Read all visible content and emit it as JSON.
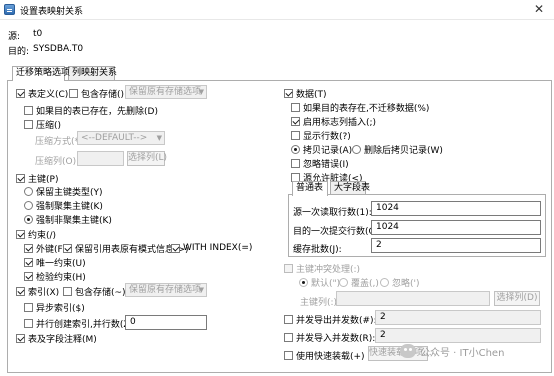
{
  "window": {
    "title": "设置表映射关系",
    "close_glyph": "✕"
  },
  "source": {
    "label": "源:",
    "value": "t0"
  },
  "target": {
    "label": "目的:",
    "value": "SYSDBA.T0"
  },
  "tabs": [
    {
      "label": "迁移策略选项",
      "active": true
    },
    {
      "label": "列映射关系",
      "active": false
    }
  ],
  "left": {
    "table_def": {
      "label": "表定义(C)",
      "checked": true
    },
    "include_storage": {
      "label": "包含存储()",
      "checked": false
    },
    "storage_combo1": "保留原有存储选项",
    "drop_if_exists": {
      "label": "如果目的表已存在，先删除(D)",
      "checked": false
    },
    "compress": {
      "label": "压缩()",
      "checked": false
    },
    "compress_method_label": "压缩方式(*):",
    "compress_method_value": "<--DEFAULT-->",
    "compress_cols_label": "压缩列(O):",
    "select_cols_btn": "选择列(L)",
    "primary_key": {
      "label": "主键(P)",
      "checked": true
    },
    "pk_opts": [
      {
        "label": "保留主键类型(Y)",
        "selected": false
      },
      {
        "label": "强制聚集主键(K)",
        "selected": false
      },
      {
        "label": "强制非聚集主键(K)",
        "selected": true
      }
    ],
    "constraint": {
      "label": "约束(/)",
      "checked": true
    },
    "foreign_key": {
      "label": "外键(F)",
      "checked": true
    },
    "keep_ref": {
      "label": "保留引用表原有模式信息(>)",
      "checked": true
    },
    "with_index": {
      "label": "WITH INDEX(=)",
      "checked": true
    },
    "unique": {
      "label": "唯一约束(U)",
      "checked": true
    },
    "check": {
      "label": "检验约束(H)",
      "checked": true
    },
    "index": {
      "label": "索引(X)",
      "checked": true
    },
    "include_storage2": {
      "label": "包含存储(~)",
      "checked": false
    },
    "storage_combo2": "保留原有存储选项",
    "async_index": {
      "label": "异步索引($)",
      "checked": false
    },
    "parallel_index": {
      "label": "并行创建索引,并行数(Z):",
      "checked": false
    },
    "parallel_value": "0",
    "comments": {
      "label": "表及字段注释(M)",
      "checked": true
    }
  },
  "right": {
    "data": {
      "label": "数据(T)",
      "checked": true
    },
    "skip_if_exists": {
      "label": "如果目的表存在,不迁移数据(%)",
      "checked": false
    },
    "identity_insert": {
      "label": "启用标志列插入(;)",
      "checked": true
    },
    "show_rows": {
      "label": "显示行数(?)",
      "checked": false
    },
    "copy_opts": [
      {
        "label": "拷贝记录(A)",
        "selected": true
      },
      {
        "label": "删除后拷贝记录(W)",
        "selected": false
      }
    ],
    "ignore_errors": {
      "label": "忽略错误(I)",
      "checked": false
    },
    "source_reads": {
      "label": "源允许脏读(<)",
      "checked": false
    },
    "subtabs": [
      "普通表",
      "大字段表"
    ],
    "read_rows_label": "源一次读取行数(1):",
    "read_rows_value": "1024",
    "commit_rows_label": "目的一次提交行数(Q):",
    "commit_rows_value": "1024",
    "batch_label": "缓存批数(J):",
    "batch_value": "2",
    "pk_conflict": {
      "label": "主键冲突处理(:)",
      "checked": false
    },
    "conflict_opts": [
      {
        "label": "默认(\")",
        "selected": true
      },
      {
        "label": "覆盖(,)",
        "selected": false
      },
      {
        "label": "忽略(')",
        "selected": false
      }
    ],
    "pk_cols_label": "主键列(:):",
    "select_cols_btn": "选择列(D)",
    "concurrent_export": {
      "label": "并发导出并发数(#):",
      "checked": false
    },
    "concurrent_export_value": "2",
    "concurrent_import": {
      "label": "并发导入并发数(R):",
      "checked": false
    },
    "concurrent_import_value": "2",
    "fast_load": {
      "label": "使用快速装载(+)",
      "checked": false
    },
    "fast_load_btn": "快速装载选项..."
  },
  "watermark": "公众号 · IT小Chen"
}
